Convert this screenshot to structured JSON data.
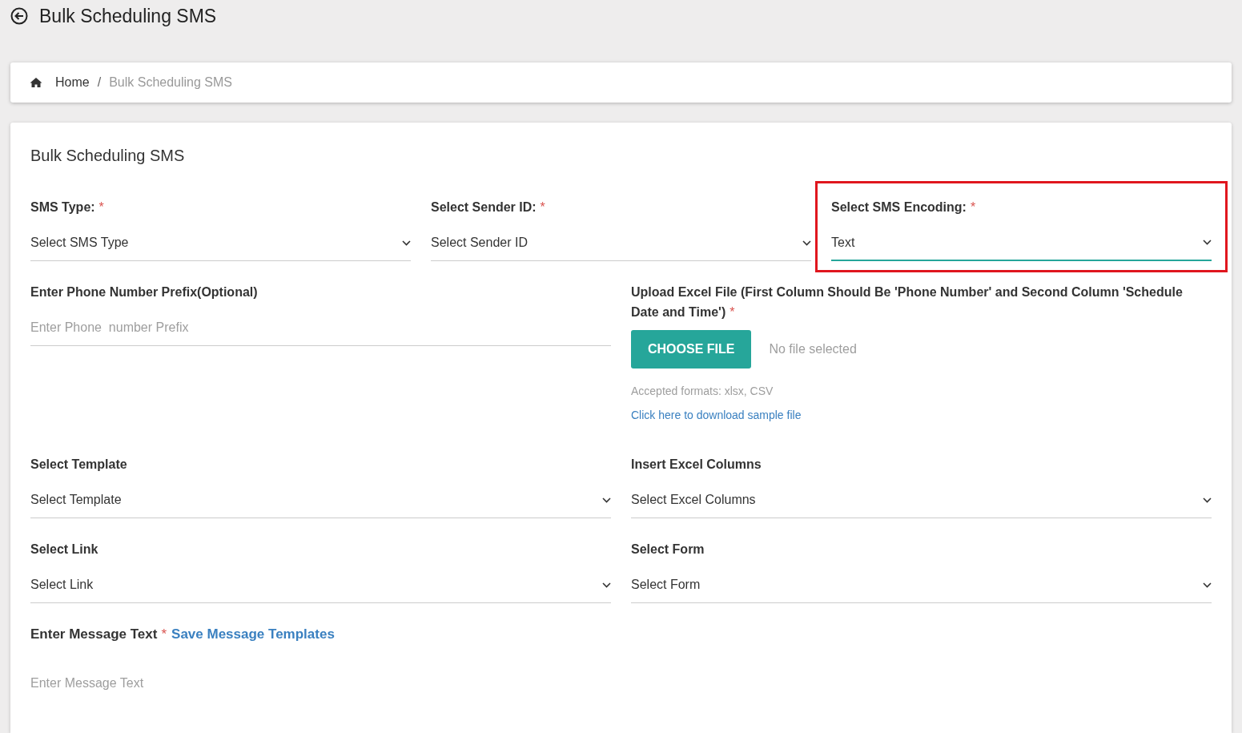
{
  "header": {
    "title": "Bulk Scheduling SMS"
  },
  "breadcrumb": {
    "separator": "/",
    "items": [
      {
        "label": "Home",
        "kind": "home"
      },
      {
        "label": "Bulk Scheduling SMS",
        "kind": "current"
      }
    ]
  },
  "form": {
    "title": "Bulk Scheduling SMS",
    "rows": [
      {
        "fields": [
          {
            "kind": "select",
            "label": "SMS Type:",
            "required_mark": "*",
            "value": "Select SMS Type",
            "focused": false,
            "highlighted": false
          },
          {
            "kind": "select",
            "label": "Select Sender ID:",
            "required_mark": "*",
            "value": "Select Sender ID",
            "focused": false,
            "highlighted": false
          },
          {
            "kind": "select",
            "label": "Select SMS Encoding:",
            "required_mark": "*",
            "value": "Text",
            "focused": true,
            "highlighted": true
          }
        ]
      },
      {
        "fields": [
          {
            "kind": "input",
            "label": "Enter Phone Number Prefix(Optional)",
            "placeholder": "Enter Phone  number Prefix"
          },
          {
            "kind": "upload",
            "label": "Upload Excel File (First Column Should Be 'Phone Number' and Second Column 'Schedule Date and Time')",
            "required_mark": "*",
            "button": "CHOOSE FILE",
            "status": "No file selected",
            "hint": "Accepted formats: xlsx, CSV",
            "link": "Click here to download sample file"
          }
        ]
      },
      {
        "fields": [
          {
            "kind": "select",
            "label": "Select Template",
            "value": "Select Template",
            "focused": false,
            "highlighted": false
          },
          {
            "kind": "select",
            "label": "Insert Excel Columns",
            "value": "Select Excel Columns",
            "focused": false,
            "highlighted": false
          }
        ]
      },
      {
        "fields": [
          {
            "kind": "select",
            "label": "Select Link",
            "value": "Select Link",
            "focused": false,
            "highlighted": false
          },
          {
            "kind": "select",
            "label": "Select Form",
            "value": "Select Form",
            "focused": false,
            "highlighted": false
          }
        ]
      },
      {
        "fields": [
          {
            "kind": "textarea",
            "label": "Enter Message Text",
            "required_mark": "*",
            "link": "Save Message Templates",
            "placeholder": "Enter Message Text"
          }
        ]
      }
    ]
  }
}
